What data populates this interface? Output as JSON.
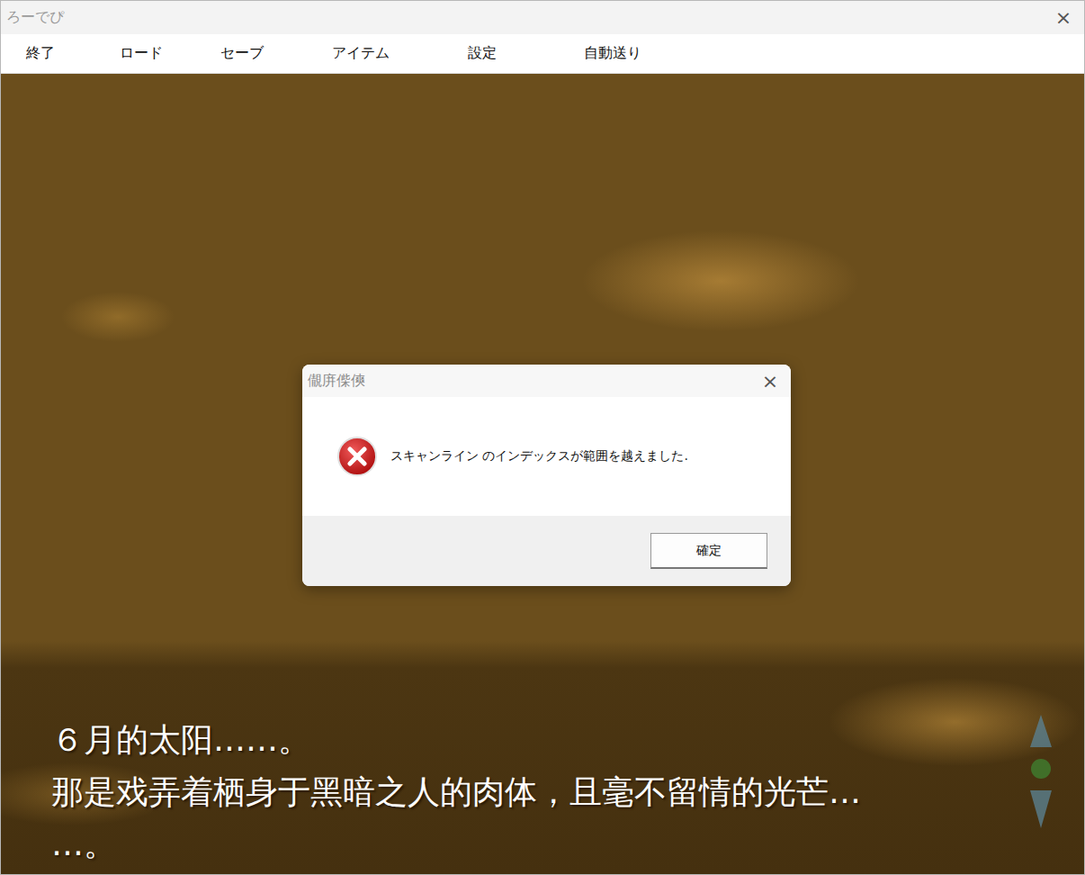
{
  "window": {
    "title": "ろーでぴ",
    "close": "×"
  },
  "menu": [
    {
      "label": "終了"
    },
    {
      "label": "ロード"
    },
    {
      "label": "セーブ"
    },
    {
      "label": "アイテム"
    },
    {
      "label": "設定"
    },
    {
      "label": "自動送り"
    }
  ],
  "text_lines": [
    "６月的太阳……。",
    "那是戏弄着栖身于黑暗之人的肉体，且毫不留情的光芒…",
    "…。"
  ],
  "dialog": {
    "title": "儬庰偨傸",
    "close": "×",
    "message": "スキャンライン のインデックスが範囲を越えました.",
    "button": "確定"
  }
}
